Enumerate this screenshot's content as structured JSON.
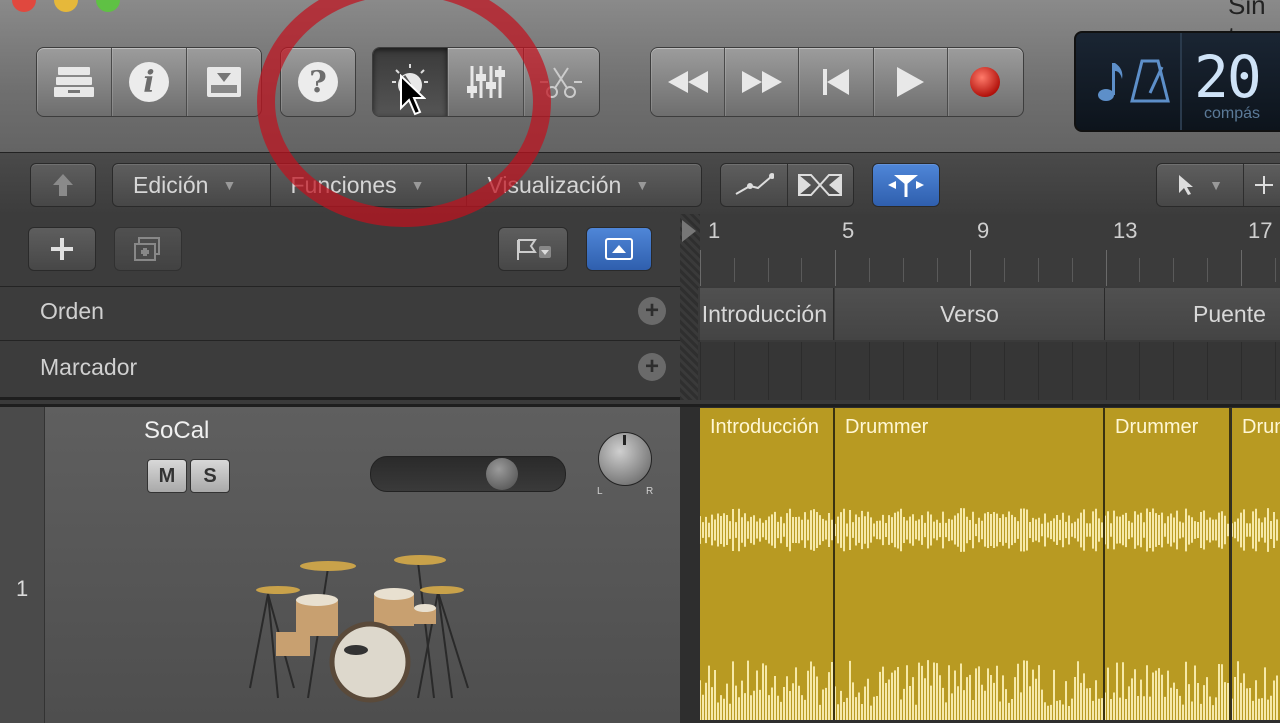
{
  "window": {
    "title": "Sin t"
  },
  "toolbar": {
    "help_label": "?",
    "info_label": "i"
  },
  "lcd": {
    "bar_value": "20",
    "bar_unit": "compás"
  },
  "menus": {
    "edit": "Edición",
    "functions": "Funciones",
    "view": "Visualización"
  },
  "global_tracks": {
    "arrangement": "Orden",
    "marker": "Marcador"
  },
  "ruler": {
    "bars": [
      "1",
      "5",
      "9",
      "13",
      "17"
    ]
  },
  "arrangement_markers": [
    {
      "label": "Introducción"
    },
    {
      "label": "Verso"
    },
    {
      "label": "Puente"
    }
  ],
  "track": {
    "number": "1",
    "name": "SoCal",
    "mute_label": "M",
    "solo_label": "S",
    "pan_left": "L",
    "pan_right": "R",
    "volume": 0.72
  },
  "regions": [
    {
      "label": "Introducción"
    },
    {
      "label": "Drummer"
    },
    {
      "label": "Drummer"
    },
    {
      "label": "Drummer"
    }
  ],
  "colors": {
    "region": "#b89a22",
    "waveform": "#f6e9a8",
    "highlight_ring": "#c0121e",
    "pressed_blue": "#3b6fc2"
  }
}
